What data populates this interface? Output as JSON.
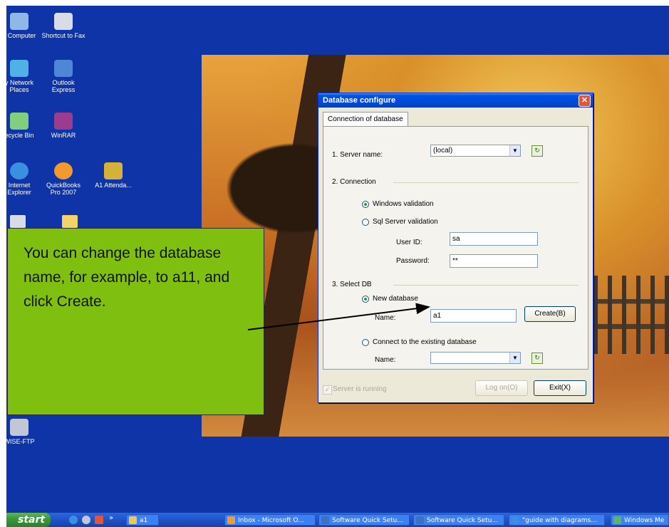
{
  "desktop": {
    "icons": [
      {
        "label": "y Computer",
        "icon": "my-computer-icon",
        "color": "#8fb7e8"
      },
      {
        "label": "Shortcut to Fax",
        "icon": "fax-icon",
        "color": "#d8dce6"
      },
      {
        "label": "y Network Places",
        "icon": "network-places-icon",
        "color": "#4fb1e5"
      },
      {
        "label": "Outlook Express",
        "icon": "outlook-express-icon",
        "color": "#4f86d6"
      },
      {
        "label": "ecycle Bin",
        "icon": "recycle-bin-icon",
        "color": "#7fcf7f"
      },
      {
        "label": "WinRAR",
        "icon": "winrar-icon",
        "color": "#9c3c8c"
      },
      {
        "label": "Internet Explorer",
        "icon": "internet-explorer-icon",
        "color": "#3b8fe0"
      },
      {
        "label": "QuickBooks Pro 2007",
        "icon": "quickbooks-icon",
        "color": "#f29a2e"
      },
      {
        "label": "A1 Attenda...",
        "icon": "a1-attendance-icon",
        "color": "#d4b23a"
      },
      {
        "label": "WISE-FTP",
        "icon": "wise-ftp-icon",
        "color": "#c0c8d8"
      }
    ]
  },
  "dialog": {
    "title": "Database configure",
    "tab_label": "Connection of database",
    "server_name_label": "1. Server name:",
    "server_name_value": "(local)",
    "connection_label": "2. Connection",
    "windows_validation_label": "Windows validation",
    "sql_validation_label": "Sql Server validation",
    "user_id_label": "User ID:",
    "user_id_value": "sa",
    "password_label": "Password:",
    "password_value": "**",
    "select_db_label": "3. Select DB",
    "new_database_label": "New database",
    "new_name_label": "Name:",
    "new_name_value": "a1",
    "create_button": "Create(B)",
    "connect_existing_label": "Connect to the existing database",
    "existing_name_label": "Name:",
    "existing_name_value": "",
    "server_running_label": "Server is running",
    "logon_button": "Log on(O)",
    "exit_button": "Exit(X)"
  },
  "callout": {
    "text": "You can change the database name, for example, to a11, and click Create."
  },
  "taskbar": {
    "start_label": "start",
    "quick_launch_chevron": "»",
    "tasks": [
      {
        "label": "a1",
        "icon": "folder-icon",
        "color": "#f2c84b"
      },
      {
        "label": "Inbox - Microsoft O...",
        "icon": "outlook-icon",
        "color": "#f29a2e"
      },
      {
        "label": "Software Quick Setu...",
        "icon": "word-doc-icon",
        "color": "#3f6fbf"
      },
      {
        "label": "Software Quick Setu...",
        "icon": "word-doc-icon",
        "color": "#3f6fbf"
      },
      {
        "label": "\"guide with diagrams...",
        "icon": "internet-explorer-icon",
        "color": "#3b8fe0"
      },
      {
        "label": "Windows Me",
        "icon": "windows-messenger-icon",
        "color": "#5fb55f"
      }
    ]
  }
}
